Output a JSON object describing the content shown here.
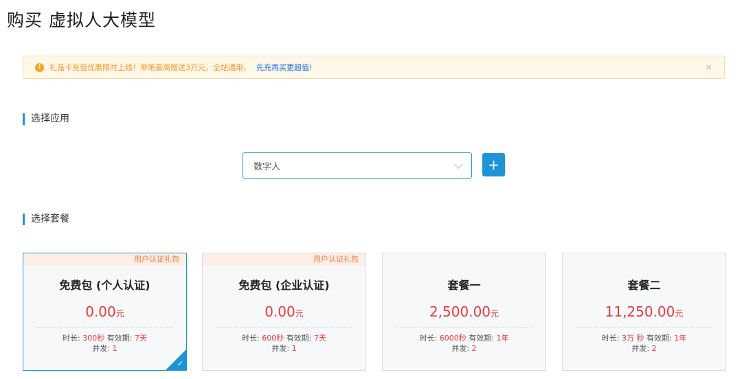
{
  "page": {
    "title": "购买 虚拟人大模型"
  },
  "notice": {
    "icon": "exclamation-circle-icon",
    "icon_glyph": "!",
    "text": "礼品卡充值优惠限时上线！单笔最高赠送3万元，全站通用，",
    "link": "先充再买更超值!",
    "close": "×"
  },
  "sections": {
    "app": "选择应用",
    "plan": "选择套餐"
  },
  "app_select": {
    "value": "数字人",
    "add_label": "+"
  },
  "labels": {
    "duration": "时长:",
    "validity": "有效期:",
    "concurrency": "并发:",
    "unit": "元"
  },
  "plans": [
    {
      "badge": "用户认证礼包",
      "name": "免费包 (个人认证)",
      "price": "0.00",
      "duration": "300秒",
      "validity": "7天",
      "concurrency": "1",
      "selected": true
    },
    {
      "badge": "用户认证礼包",
      "name": "免费包 (企业认证)",
      "price": "0.00",
      "duration": "600秒",
      "validity": "7天",
      "concurrency": "1",
      "selected": false
    },
    {
      "badge": "",
      "name": "套餐一",
      "price": "2,500.00",
      "duration": "6000秒",
      "validity": "1年",
      "concurrency": "2",
      "selected": false
    },
    {
      "badge": "",
      "name": "套餐二",
      "price": "11,250.00",
      "duration": "3万 秒",
      "validity": "1年",
      "concurrency": "2",
      "selected": false
    }
  ],
  "colors": {
    "accent": "#1d94d8",
    "price": "#e8393b",
    "notice_bg": "#fff7e8",
    "badge_text": "#f27a3a"
  }
}
